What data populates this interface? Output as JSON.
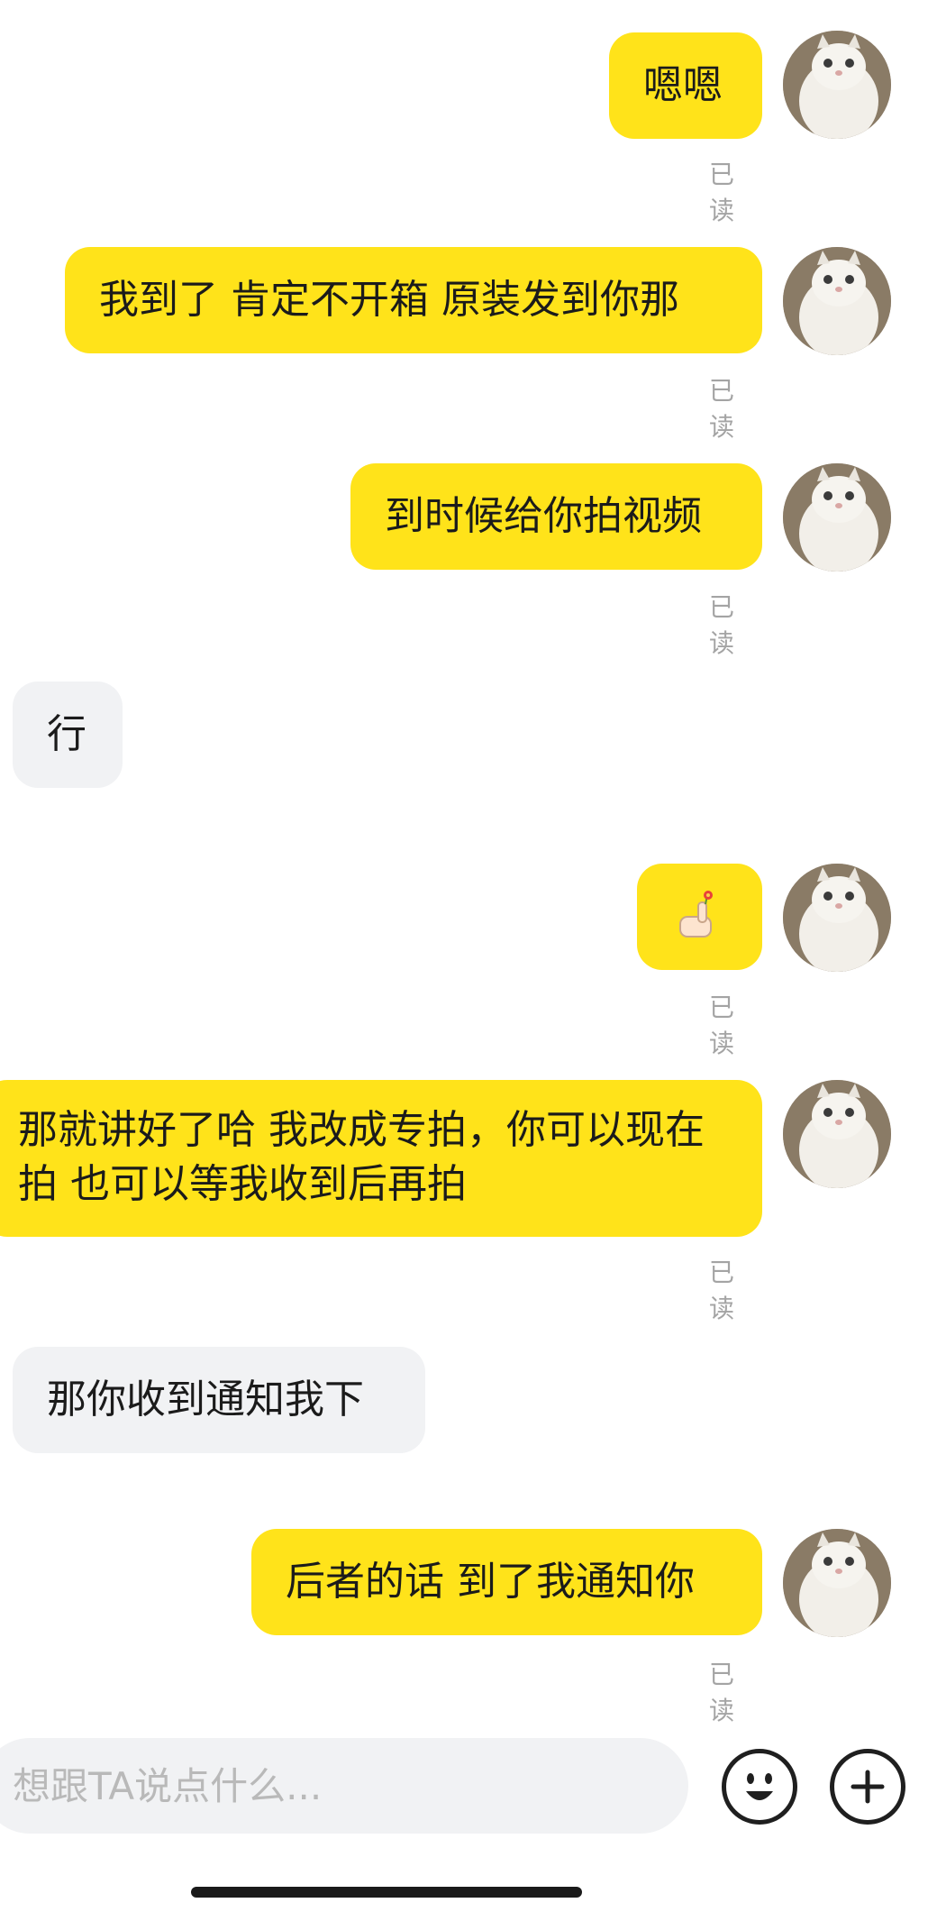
{
  "messages": [
    {
      "sender": "me",
      "text": "嗯嗯",
      "read_label": "已读"
    },
    {
      "sender": "me",
      "text": "我到了 肯定不开箱 原装发到你那",
      "read_label": "已读"
    },
    {
      "sender": "me",
      "text": "到时候给你拍视频",
      "read_label": "已读"
    },
    {
      "sender": "them",
      "text": "行"
    },
    {
      "sender": "me",
      "text": "",
      "emoji": "thumbs-up-flower",
      "read_label": "已读"
    },
    {
      "sender": "me",
      "text": "那就讲好了哈 我改成专拍，你可以现在拍 也可以等我收到后再拍",
      "read_label": "已读"
    },
    {
      "sender": "them",
      "text": "那你收到通知我下"
    },
    {
      "sender": "me",
      "text": "后者的话 到了我通知你",
      "read_label": "已读"
    }
  ],
  "composer": {
    "placeholder": "想跟TA说点什么...",
    "emoji_icon": "smiley-face-icon",
    "plus_icon": "plus-circle-icon"
  },
  "colors": {
    "my_bubble": "#ffe31a",
    "their_bubble": "#f1f2f4",
    "read_label": "#a4a4a4"
  }
}
